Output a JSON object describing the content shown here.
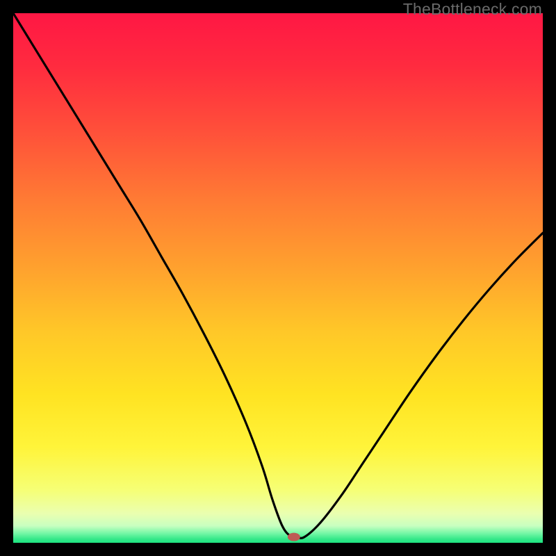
{
  "watermark": "TheBottleneck.com",
  "chart_data": {
    "type": "line",
    "title": "",
    "xlabel": "",
    "ylabel": "",
    "xlim": [
      0,
      100
    ],
    "ylim": [
      0,
      100
    ],
    "grid": false,
    "legend": false,
    "series": [
      {
        "name": "curve",
        "x": [
          0,
          4,
          8,
          12,
          16,
          20,
          24,
          28,
          32,
          36,
          40,
          44,
          47,
          49,
          50.8,
          52.3,
          53.5,
          55,
          58,
          62,
          66,
          70,
          75,
          80,
          85,
          90,
          95,
          100
        ],
        "y": [
          100,
          93.5,
          87,
          80.5,
          74,
          67.5,
          61,
          54,
          47,
          39.5,
          31.5,
          22.5,
          14.5,
          8,
          3.2,
          1.3,
          1.1,
          1.1,
          3.8,
          9,
          15,
          21,
          28.5,
          35.5,
          42,
          48,
          53.5,
          58.5
        ]
      }
    ],
    "marker": {
      "x": 53,
      "y": 1.1,
      "color": "#be5a55",
      "rx": 9,
      "ry": 6
    },
    "gradient_stops": [
      {
        "offset": 0.0,
        "color": "#ff1744"
      },
      {
        "offset": 0.1,
        "color": "#ff2b3f"
      },
      {
        "offset": 0.22,
        "color": "#ff4f3a"
      },
      {
        "offset": 0.35,
        "color": "#ff7a34"
      },
      {
        "offset": 0.48,
        "color": "#ffa12e"
      },
      {
        "offset": 0.6,
        "color": "#ffc728"
      },
      {
        "offset": 0.72,
        "color": "#ffe322"
      },
      {
        "offset": 0.82,
        "color": "#fff43a"
      },
      {
        "offset": 0.9,
        "color": "#f6ff75"
      },
      {
        "offset": 0.945,
        "color": "#eaffb0"
      },
      {
        "offset": 0.968,
        "color": "#c8ffc0"
      },
      {
        "offset": 0.982,
        "color": "#75f7a6"
      },
      {
        "offset": 0.993,
        "color": "#35e889"
      },
      {
        "offset": 1.0,
        "color": "#1de480"
      }
    ]
  }
}
